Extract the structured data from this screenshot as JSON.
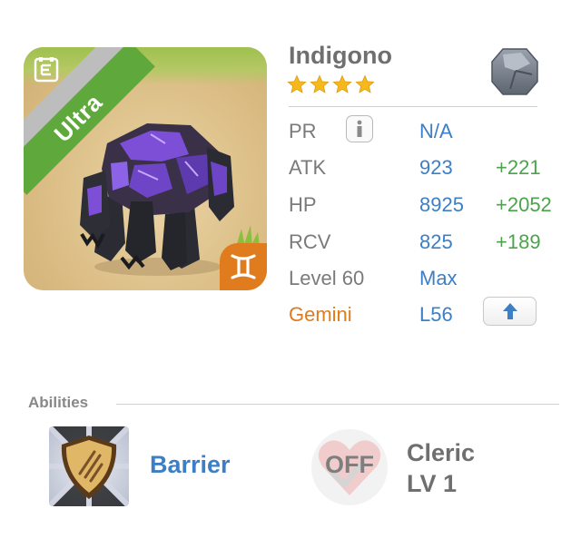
{
  "hero": {
    "rarity": "Ultra",
    "name": "Indigono",
    "star_count": 4,
    "element_icon": "rock-element-icon",
    "zodiac_icon": "gemini-icon",
    "equip_icon": "equipment-icon"
  },
  "stats": {
    "pr": {
      "label": "PR",
      "value": "N/A"
    },
    "atk": {
      "label": "ATK",
      "value": "923",
      "bonus": "+221"
    },
    "hp": {
      "label": "HP",
      "value": "8925",
      "bonus": "+2052"
    },
    "rcv": {
      "label": "RCV",
      "value": "825",
      "bonus": "+189"
    },
    "level": {
      "label": "Level 60",
      "value": "Max"
    },
    "zodiac": {
      "label": "Gemini",
      "value": "L56"
    }
  },
  "abilities": {
    "title": "Abilities",
    "primary": {
      "name": "Barrier",
      "icon": "barrier-shield-icon"
    },
    "secondary": {
      "status": "OFF",
      "name": "Cleric",
      "level": "LV 1",
      "icon": "heart-icon"
    }
  },
  "colors": {
    "ultra_green": "#5fa83b",
    "zodiac_orange": "#e07b1e",
    "value_blue": "#3d7fc4",
    "bonus_green": "#4aa44a",
    "star_gold": "#f6b81a"
  }
}
